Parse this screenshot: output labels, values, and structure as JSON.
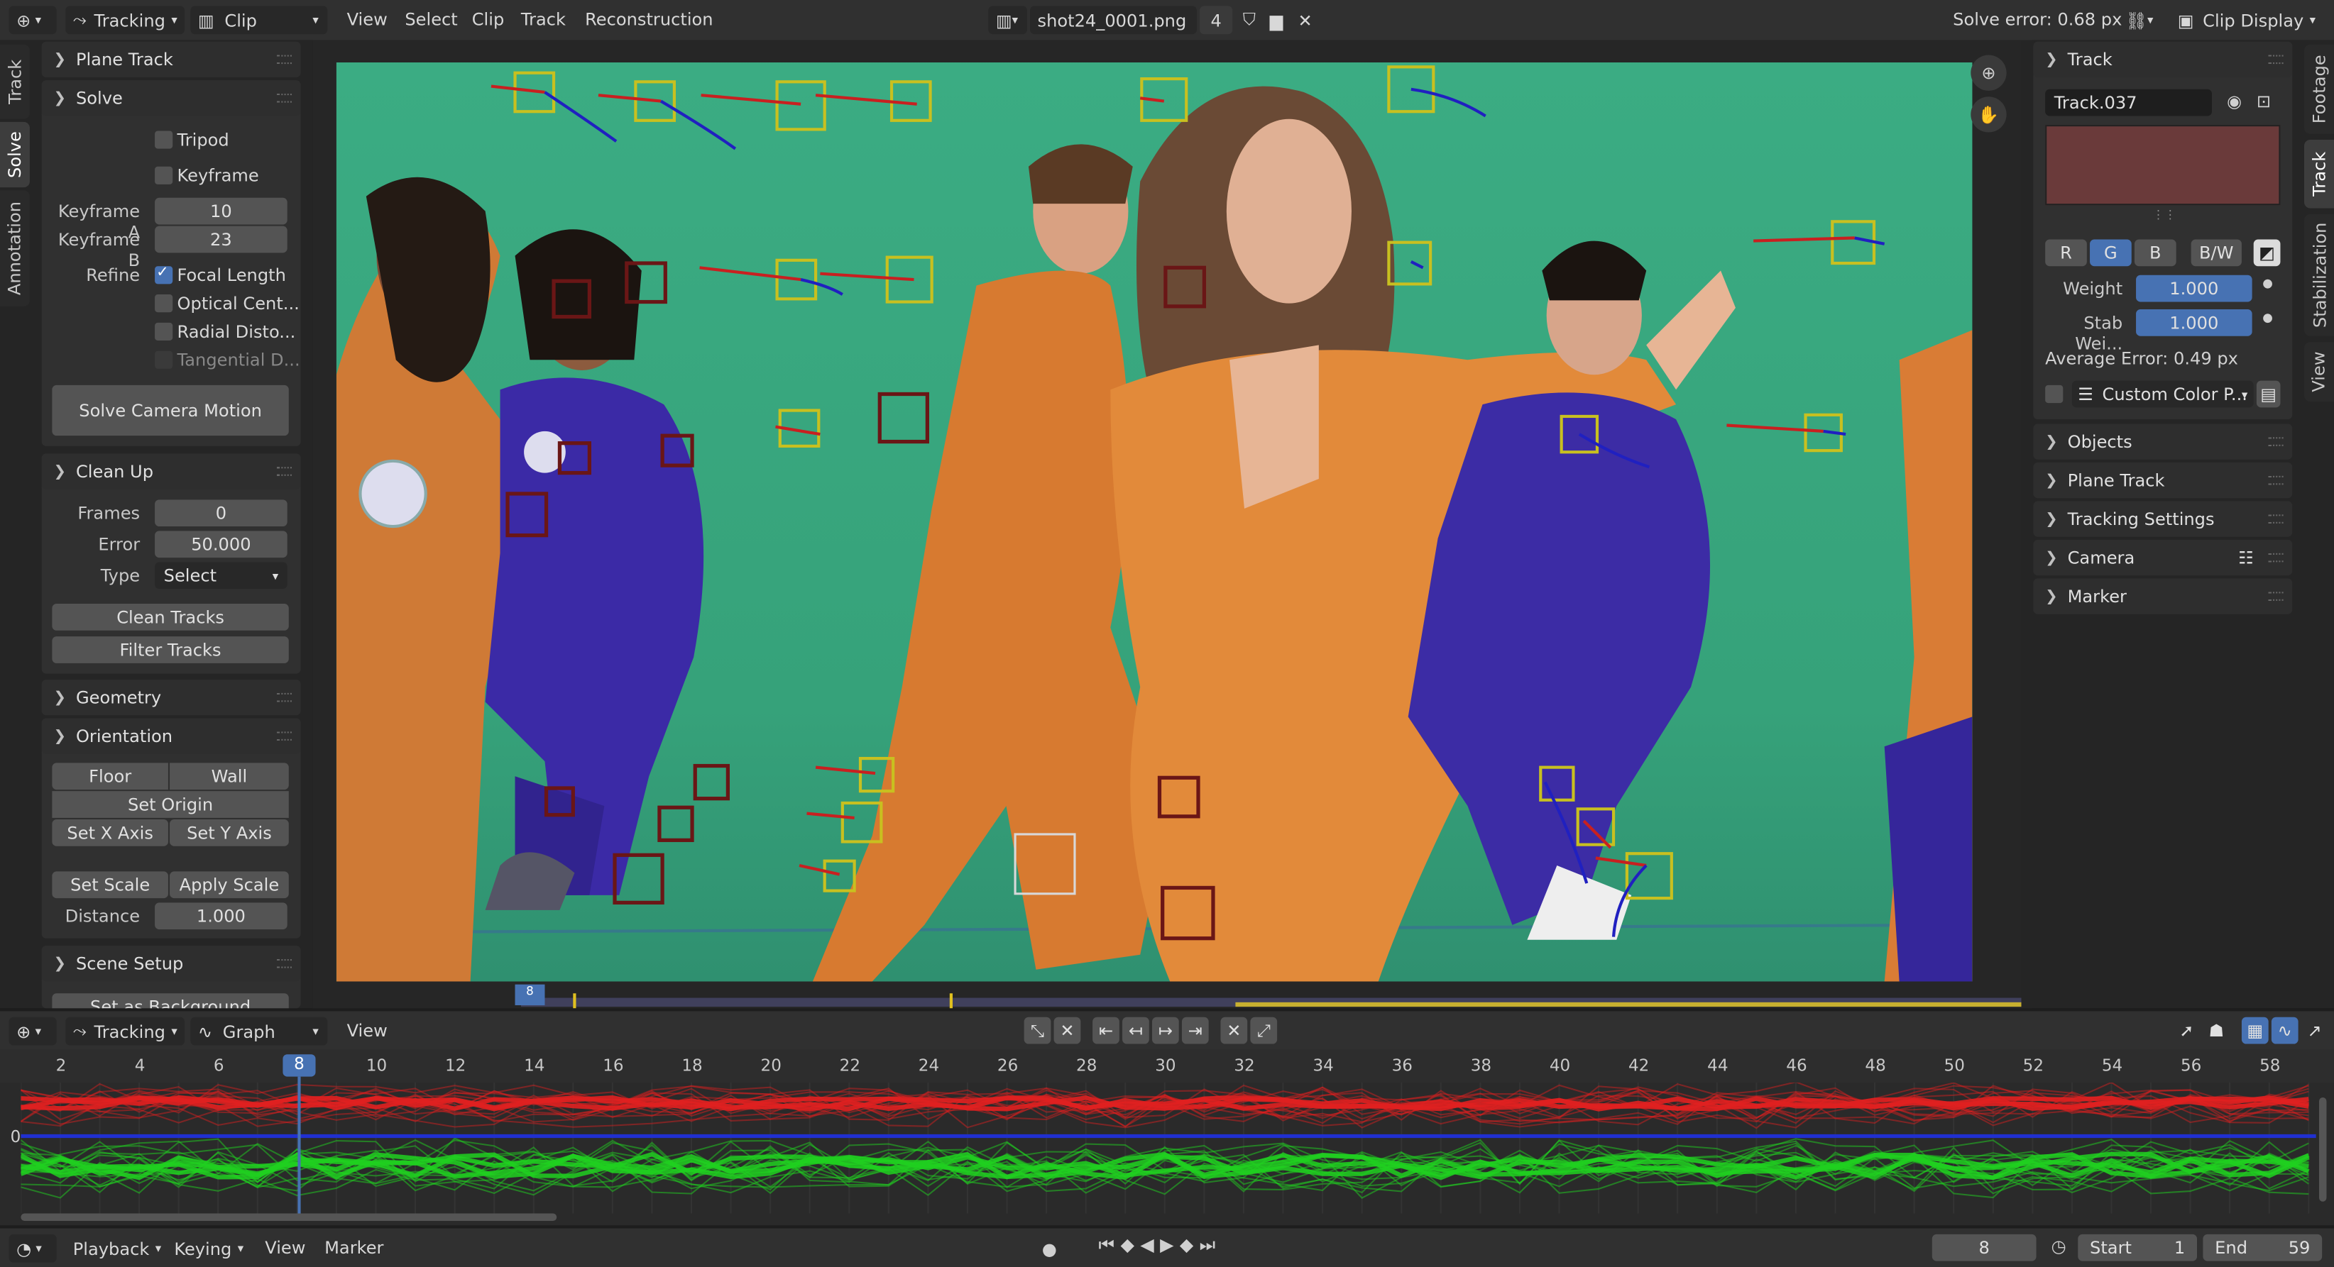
{
  "header": {
    "workspace": "Tracking",
    "mode": "Clip",
    "menus": [
      "View",
      "Select",
      "Clip",
      "Track",
      "Reconstruction"
    ],
    "clip_file": "shot24_0001.png",
    "clip_users": "4",
    "solve_error": "Solve error: 0.68 px",
    "clip_display": "Clip Display"
  },
  "left_tabs": [
    "Track",
    "Solve",
    "Annotation"
  ],
  "right_tabs": [
    "Footage",
    "Track",
    "Stabilization",
    "View"
  ],
  "solve": {
    "plane_track": "Plane Track",
    "title": "Solve",
    "tripod": "Tripod",
    "keyframe": "Keyframe",
    "keyframe_a_label": "Keyframe A",
    "keyframe_a": "10",
    "keyframe_b_label": "Keyframe B",
    "keyframe_b": "23",
    "refine_label": "Refine",
    "refine_options": [
      "Focal Length",
      "Optical Cent...",
      "Radial Disto...",
      "Tangential D..."
    ],
    "solve_button": "Solve Camera Motion"
  },
  "cleanup": {
    "title": "Clean Up",
    "frames_label": "Frames",
    "frames": "0",
    "error_label": "Error",
    "error": "50.000",
    "type_label": "Type",
    "type": "Select",
    "clean_button": "Clean Tracks",
    "filter_button": "Filter Tracks"
  },
  "geometry": {
    "title": "Geometry"
  },
  "orientation": {
    "title": "Orientation",
    "floor": "Floor",
    "wall": "Wall",
    "set_origin": "Set Origin",
    "set_x": "Set X Axis",
    "set_y": "Set Y Axis",
    "set_scale": "Set Scale",
    "apply_scale": "Apply Scale",
    "distance_label": "Distance",
    "distance": "1.000"
  },
  "scene_setup": {
    "title": "Scene Setup",
    "set_background": "Set as Background"
  },
  "track_panel": {
    "title": "Track",
    "name": "Track.037",
    "channels": [
      "R",
      "G",
      "B",
      "B/W"
    ],
    "weight_label": "Weight",
    "weight": "1.000",
    "stab_label": "Stab Wei...",
    "stab_weight": "1.000",
    "avg_error": "Average Error: 0.49 px",
    "custom_color": "Custom Color P...",
    "sections": [
      "Objects",
      "Plane Track",
      "Tracking Settings",
      "Camera",
      "Marker"
    ]
  },
  "graph_header": {
    "workspace": "Tracking",
    "mode": "Graph",
    "menu": "View"
  },
  "graph": {
    "ticks": [
      "2",
      "4",
      "6",
      "8",
      "10",
      "12",
      "14",
      "16",
      "18",
      "20",
      "22",
      "24",
      "26",
      "28",
      "30",
      "32",
      "34",
      "36",
      "38",
      "40",
      "42",
      "44",
      "46",
      "48",
      "50",
      "52",
      "54",
      "56",
      "58"
    ],
    "current_frame": "8",
    "zero_label": "0",
    "colors": {
      "x": "#e02020",
      "y": "#20d020",
      "error": "#2030d0"
    }
  },
  "timeline_mark": "8",
  "footer": {
    "menus": [
      "Playback",
      "Keying",
      "View",
      "Marker"
    ],
    "frame": "8",
    "start_label": "Start",
    "start": "1",
    "end_label": "End",
    "end": "59"
  },
  "colors": {
    "accent": "#4772b3",
    "header": "#303030",
    "panel": "#303030",
    "swatch": "#6a3a3a"
  }
}
